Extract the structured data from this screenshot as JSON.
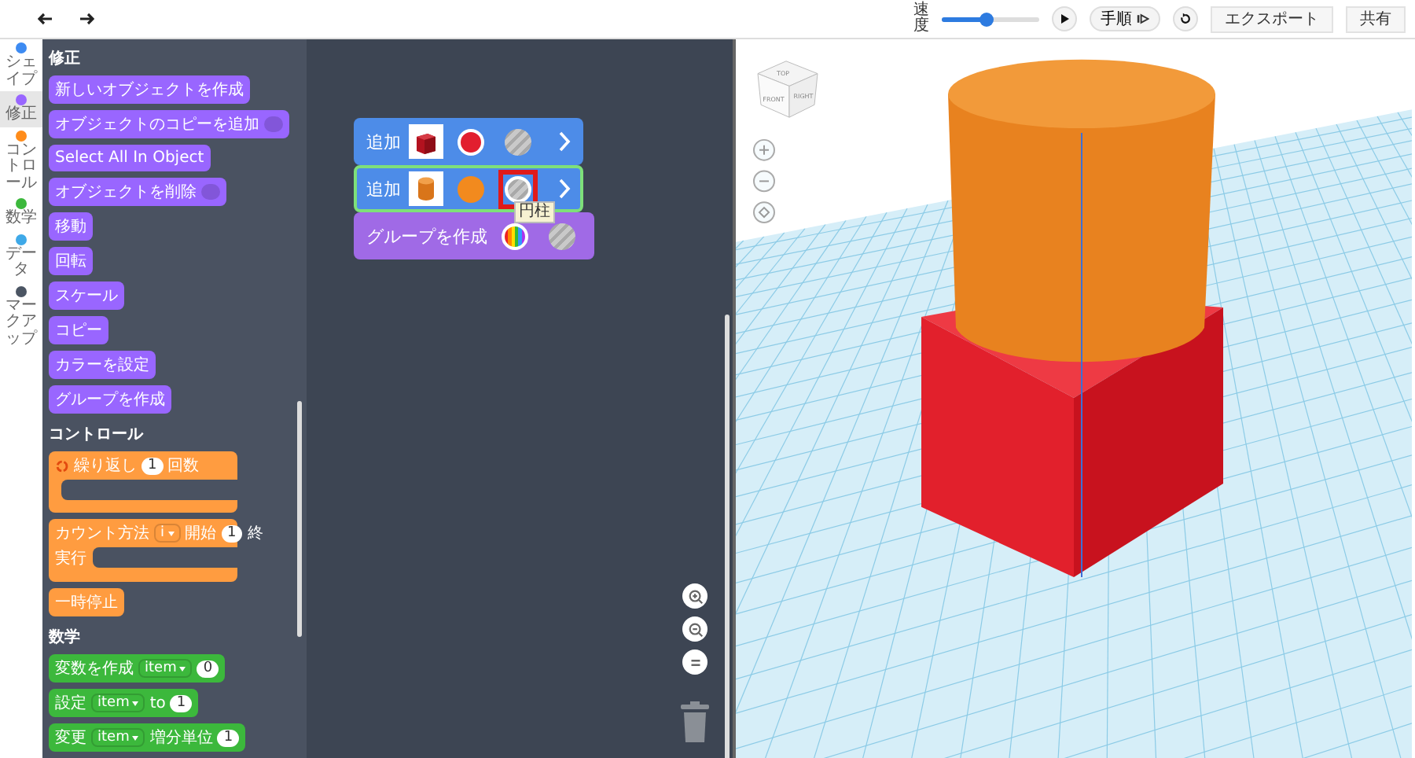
{
  "toolbar": {
    "speed_label": "速度",
    "speed": {
      "level": 0.45
    },
    "buttons": [
      {
        "kind": "play"
      },
      {
        "kind": "step",
        "label": "手順"
      },
      {
        "kind": "reset"
      },
      {
        "kind": "text",
        "label": "エクスポート"
      },
      {
        "kind": "text",
        "label": "共有"
      }
    ]
  },
  "categories": [
    {
      "label": "シェイプ",
      "color": "#3d8bf2",
      "selected": false
    },
    {
      "label": "修正",
      "color": "#9966ff",
      "selected": true
    },
    {
      "label": "コントロール",
      "color": "#ff8c1a",
      "selected": false
    },
    {
      "label": "数学",
      "color": "#3cb83c",
      "selected": false
    },
    {
      "label": "データ",
      "color": "#3fa9e8",
      "selected": false
    },
    {
      "label": "マークアップ",
      "color": "#4b5563",
      "selected": false
    }
  ],
  "palette": [
    {
      "heading": "修正",
      "color": "#9966ff",
      "blocks": [
        {
          "kind": "stack",
          "parts": [
            {
              "kind": "text",
              "text": "新しいオブジェクトを作成"
            }
          ]
        },
        {
          "kind": "stack",
          "parts": [
            {
              "kind": "text",
              "text": "オブジェクトのコピーを追加"
            },
            {
              "kind": "slot"
            }
          ]
        },
        {
          "kind": "stack",
          "parts": [
            {
              "kind": "text",
              "text": "Select All In Object"
            }
          ]
        },
        {
          "kind": "stack",
          "parts": [
            {
              "kind": "text",
              "text": "オブジェクトを削除"
            },
            {
              "kind": "slot"
            }
          ]
        },
        {
          "kind": "stack",
          "parts": [
            {
              "kind": "text",
              "text": "移動"
            }
          ]
        },
        {
          "kind": "stack",
          "parts": [
            {
              "kind": "text",
              "text": "回転"
            }
          ]
        },
        {
          "kind": "stack",
          "parts": [
            {
              "kind": "text",
              "text": "スケール"
            }
          ]
        },
        {
          "kind": "stack",
          "parts": [
            {
              "kind": "text",
              "text": "コピー"
            }
          ]
        },
        {
          "kind": "stack",
          "parts": [
            {
              "kind": "text",
              "text": "カラーを設定"
            }
          ]
        },
        {
          "kind": "stack",
          "parts": [
            {
              "kind": "text",
              "text": "グループを作成"
            }
          ]
        }
      ]
    },
    {
      "heading": "コントロール",
      "color": "#ff9c40",
      "blocks": [
        {
          "kind": "c",
          "parts": [
            {
              "kind": "loop"
            },
            {
              "kind": "text",
              "text": "繰り返し"
            },
            {
              "kind": "num",
              "text": "1"
            },
            {
              "kind": "text",
              "text": "回数"
            }
          ]
        },
        {
          "kind": "c",
          "parts": [
            {
              "kind": "text",
              "text": "カウント方法"
            },
            {
              "kind": "dropdown",
              "text": "i"
            },
            {
              "kind": "text",
              "text": "開始"
            },
            {
              "kind": "num",
              "text": "1"
            },
            {
              "kind": "text",
              "text": "終"
            }
          ],
          "inner_parts": [
            {
              "kind": "text",
              "text": "実行"
            }
          ]
        },
        {
          "kind": "stack",
          "parts": [
            {
              "kind": "text",
              "text": "一時停止"
            }
          ]
        }
      ]
    },
    {
      "heading": "数学",
      "color": "#3cb83c",
      "blocks": [
        {
          "kind": "stack",
          "parts": [
            {
              "kind": "text",
              "text": "変数を作成"
            },
            {
              "kind": "dropdown",
              "text": "item"
            },
            {
              "kind": "num",
              "text": "0"
            }
          ]
        },
        {
          "kind": "stack",
          "parts": [
            {
              "kind": "text",
              "text": "設定"
            },
            {
              "kind": "dropdown",
              "text": "item"
            },
            {
              "kind": "text",
              "text": "to"
            },
            {
              "kind": "num",
              "text": "1"
            }
          ]
        },
        {
          "kind": "stack",
          "parts": [
            {
              "kind": "text",
              "text": "変更"
            },
            {
              "kind": "dropdown",
              "text": "item"
            },
            {
              "kind": "text",
              "text": "増分単位"
            },
            {
              "kind": "num",
              "text": "1"
            }
          ]
        }
      ]
    }
  ],
  "workspace": {
    "blocks": [
      {
        "kind": "add",
        "label": "追加",
        "selected": false,
        "thumbnail": {
          "kind": "cube"
        },
        "swatches": [
          {
            "kind": "color",
            "color": "#e21f2f",
            "selected": true,
            "highlighted": false
          },
          {
            "kind": "striped",
            "selected": false,
            "highlighted": false
          }
        ]
      },
      {
        "kind": "add",
        "label": "追加",
        "selected": true,
        "thumbnail": {
          "kind": "cylinder"
        },
        "swatches": [
          {
            "kind": "color",
            "color": "#f28a1e",
            "selected": false,
            "highlighted": false
          },
          {
            "kind": "striped",
            "selected": true,
            "highlighted": true,
            "tooltip": "円柱"
          }
        ]
      },
      {
        "kind": "group",
        "label": "グループを作成",
        "selected": false,
        "swatches": [
          {
            "kind": "rainbow",
            "selected": true,
            "highlighted": false
          },
          {
            "kind": "striped",
            "selected": false,
            "highlighted": false
          }
        ]
      }
    ]
  },
  "viewport": {
    "nav_cube": {
      "top": "TOP",
      "front": "FRONT",
      "right": "RIGHT"
    }
  }
}
